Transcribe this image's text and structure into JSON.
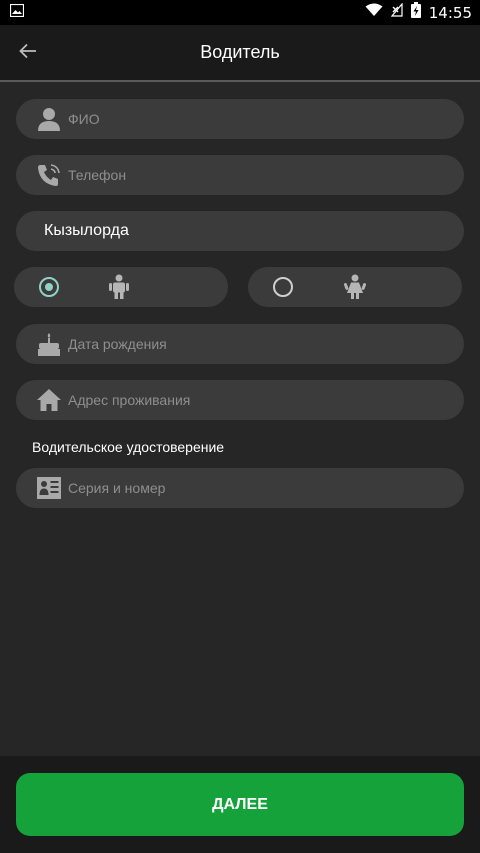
{
  "status_bar": {
    "time": "14:55",
    "icons": [
      "image-icon",
      "wifi-icon",
      "no-signal-icon",
      "battery-charging-icon"
    ]
  },
  "app_bar": {
    "title": "Водитель",
    "back_icon": "arrow-left-icon"
  },
  "form": {
    "full_name": {
      "placeholder": "ФИО",
      "icon": "person-icon"
    },
    "phone": {
      "placeholder": "Телефон",
      "icon": "phone-icon"
    },
    "city": {
      "value": "Кызылорда"
    },
    "gender": {
      "male": {
        "selected": true,
        "icon": "male-icon"
      },
      "female": {
        "selected": false,
        "icon": "female-icon"
      }
    },
    "birth_date": {
      "placeholder": "Дата рождения",
      "icon": "cake-icon"
    },
    "address": {
      "placeholder": "Адрес проживания",
      "icon": "home-icon"
    },
    "license_label": "Водительское удостоверение",
    "license_number": {
      "placeholder": "Серия и номер",
      "icon": "id-card-icon"
    }
  },
  "actions": {
    "next_label": "ДАЛЕЕ"
  },
  "colors": {
    "background": "#262626",
    "field": "#3b3b3b",
    "app_bar": "#1a1a1a",
    "accent_green": "#15a23a",
    "radio_selected": "#8fd3c3"
  }
}
